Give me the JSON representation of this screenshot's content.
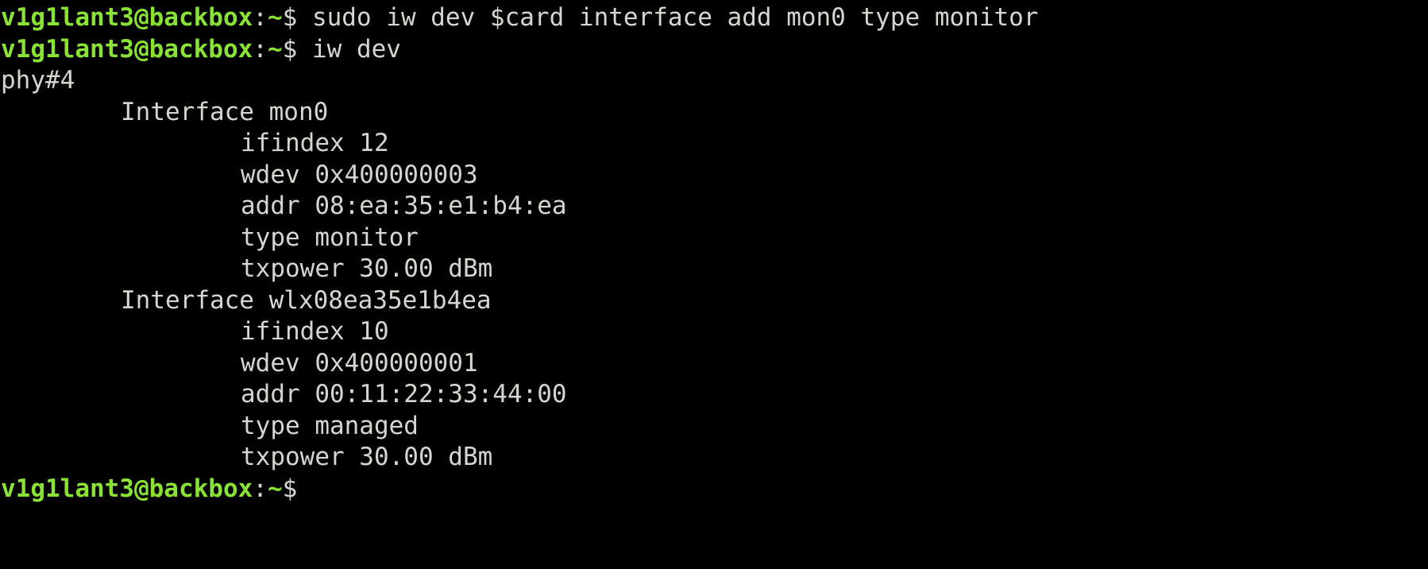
{
  "terminal": {
    "prompt": {
      "userhost": "v1g1lant3@backbox",
      "sep": ":",
      "path": "~",
      "symbol": "$"
    },
    "commands": {
      "cmd1": " sudo iw dev $card interface add mon0 type monitor",
      "cmd2": " iw dev"
    },
    "output": {
      "phy": "phy#4",
      "iface1": {
        "header": "Interface mon0",
        "ifindex": "ifindex 12",
        "wdev": "wdev 0x400000003",
        "addr": "addr 08:ea:35:e1:b4:ea",
        "type": "type monitor",
        "txpower": "txpower 30.00 dBm"
      },
      "iface2": {
        "header": "Interface wlx08ea35e1b4ea",
        "ifindex": "ifindex 10",
        "wdev": "wdev 0x400000001",
        "addr": "addr 00:11:22:33:44:00",
        "type": "type managed",
        "txpower": "txpower 30.00 dBm"
      }
    },
    "colors": {
      "background": "#000000",
      "text": "#d3d7cf",
      "prompt": "#8ae234"
    }
  }
}
